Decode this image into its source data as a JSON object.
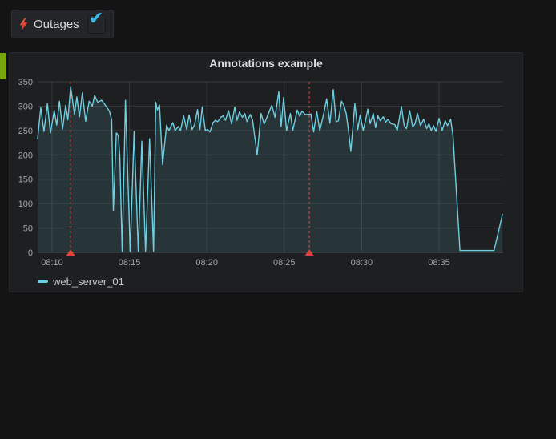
{
  "toolbar": {
    "outages_control": {
      "icon": "lightning-icon",
      "label": "Outages",
      "checked": true,
      "check_glyph": "✔"
    }
  },
  "panel": {
    "title": "Annotations example",
    "legend": [
      {
        "label": "web_server_01",
        "color": "#6fcfe0"
      }
    ]
  },
  "chart_data": {
    "type": "line",
    "title": "Annotations example",
    "x_unit": "time (HH:MM), minutes after 08:00 as numeric t",
    "x_range": [
      9.07,
      39.14
    ],
    "y_range": [
      0,
      350
    ],
    "y_ticks": [
      0,
      50,
      100,
      150,
      200,
      250,
      300,
      350
    ],
    "x_ticks": [
      {
        "t": 10,
        "label": "08:10"
      },
      {
        "t": 15,
        "label": "08:15"
      },
      {
        "t": 20,
        "label": "08:20"
      },
      {
        "t": 25,
        "label": "08:25"
      },
      {
        "t": 30,
        "label": "08:30"
      },
      {
        "t": 35,
        "label": "08:35"
      }
    ],
    "grid": true,
    "legend_position": "bottom-left",
    "annotations": [
      {
        "t": 11.2,
        "style": "dashed",
        "marker": "triangle-up"
      },
      {
        "t": 26.62,
        "style": "dashed",
        "marker": "triangle-up"
      }
    ],
    "colors": {
      "line": "#6fcfe0",
      "fill": "rgba(111,207,224,0.12)",
      "grid": "#38393c",
      "axis": "#505255",
      "annotation": "#e5413b",
      "tick_text": "#a1a3a6"
    },
    "series": [
      {
        "name": "web_server_01",
        "color": "#6fcfe0",
        "points": [
          [
            9.07,
            233
          ],
          [
            9.27,
            297
          ],
          [
            9.48,
            248
          ],
          [
            9.7,
            305
          ],
          [
            9.9,
            245
          ],
          [
            10.14,
            291
          ],
          [
            10.3,
            261
          ],
          [
            10.48,
            310
          ],
          [
            10.68,
            253
          ],
          [
            10.88,
            302
          ],
          [
            11.02,
            272
          ],
          [
            11.2,
            340
          ],
          [
            11.45,
            283
          ],
          [
            11.6,
            319
          ],
          [
            11.77,
            278
          ],
          [
            11.96,
            327
          ],
          [
            12.17,
            269
          ],
          [
            12.4,
            310
          ],
          [
            12.6,
            300
          ],
          [
            12.75,
            322
          ],
          [
            12.95,
            308
          ],
          [
            13.2,
            312
          ],
          [
            13.44,
            302
          ],
          [
            13.7,
            290
          ],
          [
            13.85,
            272
          ],
          [
            13.96,
            85
          ],
          [
            14.15,
            245
          ],
          [
            14.28,
            240
          ],
          [
            14.38,
            195
          ],
          [
            14.53,
            2
          ],
          [
            14.74,
            312
          ],
          [
            15.05,
            2
          ],
          [
            15.3,
            248
          ],
          [
            15.57,
            2
          ],
          [
            15.8,
            228
          ],
          [
            16.04,
            2
          ],
          [
            16.3,
            233
          ],
          [
            16.56,
            2
          ],
          [
            16.7,
            308
          ],
          [
            16.8,
            292
          ],
          [
            16.94,
            302
          ],
          [
            17.14,
            180
          ],
          [
            17.4,
            261
          ],
          [
            17.55,
            250
          ],
          [
            17.8,
            266
          ],
          [
            17.95,
            250
          ],
          [
            18.15,
            258
          ],
          [
            18.3,
            250
          ],
          [
            18.5,
            280
          ],
          [
            18.7,
            252
          ],
          [
            18.85,
            282
          ],
          [
            19.05,
            252
          ],
          [
            19.2,
            261
          ],
          [
            19.4,
            293
          ],
          [
            19.55,
            252
          ],
          [
            19.7,
            298
          ],
          [
            19.9,
            250
          ],
          [
            20.05,
            252
          ],
          [
            20.2,
            247
          ],
          [
            20.4,
            266
          ],
          [
            20.55,
            271
          ],
          [
            20.7,
            268
          ],
          [
            20.9,
            277
          ],
          [
            21.05,
            280
          ],
          [
            21.2,
            271
          ],
          [
            21.4,
            291
          ],
          [
            21.6,
            263
          ],
          [
            21.8,
            298
          ],
          [
            21.95,
            271
          ],
          [
            22.1,
            288
          ],
          [
            22.3,
            277
          ],
          [
            22.45,
            285
          ],
          [
            22.6,
            268
          ],
          [
            22.8,
            283
          ],
          [
            22.95,
            272
          ],
          [
            23.25,
            200
          ],
          [
            23.5,
            285
          ],
          [
            23.7,
            263
          ],
          [
            24.2,
            302
          ],
          [
            24.4,
            277
          ],
          [
            24.65,
            330
          ],
          [
            24.8,
            258
          ],
          [
            24.96,
            318
          ],
          [
            25.15,
            250
          ],
          [
            25.4,
            285
          ],
          [
            25.55,
            250
          ],
          [
            25.84,
            292
          ],
          [
            26.0,
            279
          ],
          [
            26.15,
            290
          ],
          [
            26.35,
            283
          ],
          [
            26.55,
            283
          ],
          [
            26.72,
            284
          ],
          [
            26.9,
            247
          ],
          [
            27.1,
            289
          ],
          [
            27.3,
            250
          ],
          [
            27.55,
            285
          ],
          [
            27.74,
            315
          ],
          [
            27.95,
            265
          ],
          [
            28.17,
            334
          ],
          [
            28.35,
            268
          ],
          [
            28.5,
            270
          ],
          [
            28.7,
            310
          ],
          [
            28.85,
            302
          ],
          [
            29.0,
            285
          ],
          [
            29.15,
            250
          ],
          [
            29.3,
            207
          ],
          [
            29.56,
            305
          ],
          [
            29.75,
            252
          ],
          [
            29.9,
            282
          ],
          [
            30.1,
            250
          ],
          [
            30.25,
            270
          ],
          [
            30.4,
            294
          ],
          [
            30.55,
            264
          ],
          [
            30.75,
            285
          ],
          [
            30.9,
            256
          ],
          [
            31.05,
            280
          ],
          [
            31.2,
            270
          ],
          [
            31.4,
            278
          ],
          [
            31.55,
            267
          ],
          [
            31.7,
            273
          ],
          [
            31.9,
            264
          ],
          [
            32.15,
            262
          ],
          [
            32.3,
            250
          ],
          [
            32.57,
            299
          ],
          [
            32.75,
            260
          ],
          [
            32.9,
            254
          ],
          [
            33.1,
            291
          ],
          [
            33.3,
            257
          ],
          [
            33.45,
            264
          ],
          [
            33.6,
            285
          ],
          [
            33.8,
            260
          ],
          [
            34.0,
            273
          ],
          [
            34.2,
            254
          ],
          [
            34.35,
            264
          ],
          [
            34.5,
            250
          ],
          [
            34.65,
            260
          ],
          [
            34.8,
            248
          ],
          [
            35.0,
            275
          ],
          [
            35.2,
            250
          ],
          [
            35.4,
            270
          ],
          [
            35.55,
            260
          ],
          [
            35.75,
            273
          ],
          [
            35.9,
            240
          ],
          [
            36.35,
            4
          ],
          [
            37.0,
            4
          ],
          [
            37.6,
            4
          ],
          [
            38.2,
            4
          ],
          [
            38.55,
            4
          ],
          [
            39.1,
            78
          ]
        ]
      }
    ]
  }
}
